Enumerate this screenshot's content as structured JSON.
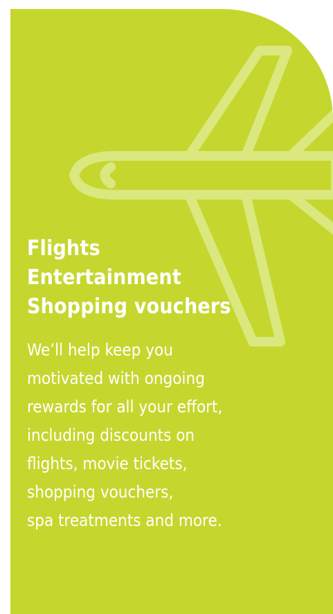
{
  "colors": {
    "card_background": "#c5d72e",
    "plane_outline": "#dbe77f",
    "text": "#ffffff",
    "page_background": "#ffffff"
  },
  "icon": "airplane-icon",
  "headline": {
    "lines": [
      "Flights",
      "Entertainment",
      "Shopping vouchers"
    ]
  },
  "body": {
    "lines": [
      "We’ll help keep you",
      "motivated with ongoing",
      "rewards for all your effort,",
      "including discounts on",
      "flights, movie tickets,",
      "shopping vouchers,",
      "spa treatments and more."
    ]
  }
}
